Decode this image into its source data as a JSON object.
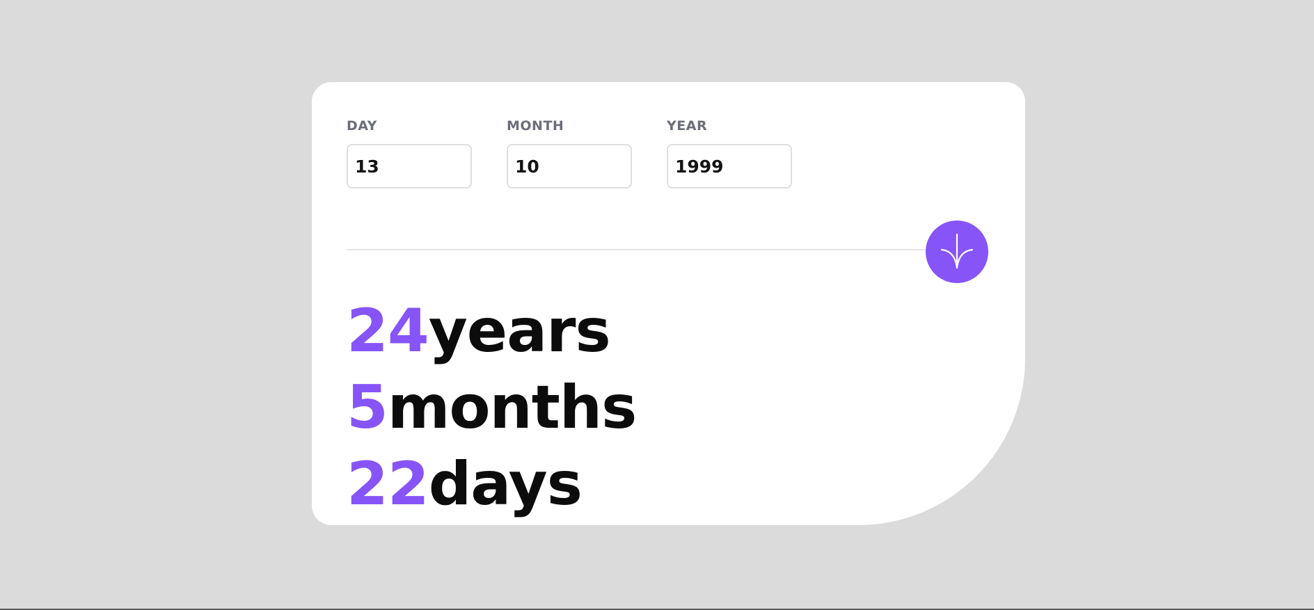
{
  "form": {
    "day": {
      "label": "DAY",
      "value": "13"
    },
    "month": {
      "label": "MONTH",
      "value": "10"
    },
    "year": {
      "label": "YEAR",
      "value": "1999"
    }
  },
  "submit": {
    "icon": "arrow-down-icon"
  },
  "results": {
    "years": {
      "value": "24",
      "unit": "years"
    },
    "months": {
      "value": "5",
      "unit": "months"
    },
    "days": {
      "value": "22",
      "unit": "days"
    }
  },
  "colors": {
    "accent": "#8754f8",
    "background": "#dbdbdb",
    "card": "#ffffff",
    "text": "#0c0c0c",
    "label": "#6b6e78"
  }
}
